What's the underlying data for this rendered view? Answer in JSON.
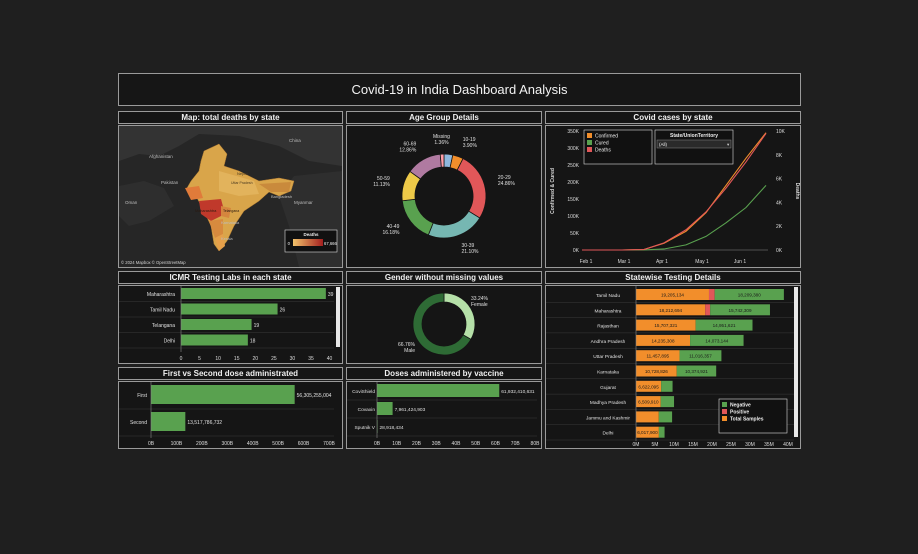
{
  "title": "Covid-19 in India Dashboard Analysis",
  "panels": {
    "map": {
      "header": "Map: total deaths by state",
      "attribution": "© 2024 Mapbox © OpenStreetMap",
      "legend_title": "Deaths",
      "legend_min": "0",
      "legend_max": "67,666",
      "labels": [
        "Afghanistan",
        "Pakistan",
        "China",
        "Nepal",
        "Bangladesh",
        "Myanmar",
        "Maharashtra",
        "Telangana",
        "Karnataka",
        "Kerala",
        "Uttar Pradesh",
        "Oman"
      ]
    },
    "age": {
      "header": "Age Group Details"
    },
    "cases": {
      "header": "Covid cases by state",
      "filter_title": "State/UnionTerritory",
      "filter_value": "(All)"
    },
    "icmr": {
      "header": "ICMR Testing Labs in each state"
    },
    "gender": {
      "header": "Gender without missing values"
    },
    "testing": {
      "header": "Statewise Testing Details"
    },
    "dose": {
      "header": "First vs Second dose administrated"
    },
    "vaccine": {
      "header": "Doses administered by vaccine"
    }
  },
  "chart_data": [
    {
      "id": "age",
      "type": "pie",
      "title": "Age Group Details",
      "categories": [
        "0-9",
        "10-19",
        "20-29",
        "30-39",
        "40-49",
        "50-59",
        "60-69",
        "Missing"
      ],
      "values": [
        3.18,
        3.9,
        24.86,
        21.1,
        16.18,
        11.13,
        12.86,
        1.36
      ],
      "labels": [
        "",
        "10-19\n3.90%",
        "20-29\n24.86%",
        "30-39\n21.10%",
        "40-49\n16.18%",
        "50-59\n11.13%",
        "60-69\n12.86%",
        "Missing\n1.36%"
      ],
      "colors": [
        "#8fb8dd",
        "#f28e2b",
        "#e15759",
        "#76b7b2",
        "#59a14f",
        "#edc948",
        "#b07aa1",
        "#ff9da7"
      ]
    },
    {
      "id": "cases",
      "type": "line",
      "title": "Covid cases by state",
      "x": [
        "Feb 1",
        "Mar 1",
        "Apr 1",
        "May 1",
        "Jun 1"
      ],
      "ylabel": "Confirmed & Cured",
      "y2label": "Deaths",
      "yticks": [
        "0K",
        "50K",
        "100K",
        "150K",
        "200K",
        "250K",
        "300K",
        "350K"
      ],
      "y2ticks": [
        "0K",
        "2K",
        "4K",
        "6K",
        "8K",
        "10K"
      ],
      "ylim": [
        0,
        350000
      ],
      "y2lim": [
        0,
        10000
      ],
      "legend": [
        "Confirmed",
        "Cured",
        "Deaths"
      ],
      "legend_position": "top-left",
      "colors": [
        "#f28e2b",
        "#59a14f",
        "#e15759"
      ],
      "series": [
        {
          "name": "Confirmed",
          "values": [
            0,
            0,
            1500,
            20000,
            55000,
            110000,
            190000,
            270000,
            345000
          ]
        },
        {
          "name": "Cured",
          "values": [
            0,
            0,
            100,
            3000,
            15000,
            40000,
            80000,
            125000,
            190000
          ]
        },
        {
          "name": "Deaths",
          "values": [
            0,
            0,
            40,
            600,
            1700,
            3200,
            5200,
            7400,
            9800
          ]
        }
      ],
      "points": [
        "Feb 1",
        "Mar 1",
        "Mar 15",
        "Apr 1",
        "Apr 15",
        "May 1",
        "May 15",
        "Jun 1",
        "Jun 15"
      ]
    },
    {
      "id": "icmr",
      "type": "bar",
      "title": "ICMR Testing Labs in each state",
      "categories": [
        "Maharashtra",
        "Tamil Nadu",
        "Telangana",
        "Delhi"
      ],
      "values": [
        39,
        26,
        19,
        18
      ],
      "xticks": [
        "0",
        "5",
        "10",
        "15",
        "20",
        "25",
        "30",
        "35",
        "40"
      ],
      "xlim": [
        0,
        42
      ],
      "color": "#59a14f"
    },
    {
      "id": "gender",
      "type": "pie",
      "title": "Gender without missing values",
      "categories": [
        "Female",
        "Male"
      ],
      "values": [
        33.24,
        66.76
      ],
      "labels": [
        "33.24%\nFemale",
        "66.76%\nMale"
      ],
      "colors": [
        "#b5e0a8",
        "#2e6b35"
      ]
    },
    {
      "id": "testing",
      "type": "bar",
      "title": "Statewise Testing Details",
      "categories": [
        "Tamil Nadu",
        "Maharashtra",
        "Rajasthan",
        "Andhra Pradesh",
        "Uttar Pradesh",
        "Karnataka",
        "Gujarat",
        "Madhya Pradesh",
        "Jammu and Kashmir",
        "Delhi"
      ],
      "series": [
        {
          "name": "Total Samples",
          "values": [
            19205134,
            18212694,
            15707321,
            14235308,
            11457895,
            10728826,
            0,
            0,
            0,
            0
          ],
          "labels": [
            "19,205,134",
            "18,212,694",
            "15,707,321",
            "14,235,308",
            "11,457,895",
            "10,728,826",
            "",
            "",
            "",
            ""
          ]
        },
        {
          "name": "Positive",
          "values": [
            1500000,
            1300000,
            0,
            0,
            0,
            0,
            0,
            0,
            0,
            0
          ]
        },
        {
          "name": "Negative",
          "values": [
            18209380,
            15742309,
            14951621,
            14073144,
            11016357,
            10374921,
            3000000,
            3500000,
            3500000,
            1500000
          ],
          "labels": [
            "18,209,380",
            "15,742,309",
            "14,951,621",
            "14,073,144",
            "11,016,357",
            "10,374,921",
            "",
            "",
            "",
            ""
          ]
        }
      ],
      "small_labels": [
        "",
        "",
        "",
        "",
        "",
        "",
        "6,622,095",
        "6,509,910",
        "",
        "6,017,900"
      ],
      "small_totals": [
        0,
        0,
        0,
        0,
        0,
        0,
        6622095,
        6509910,
        6000000,
        6017900
      ],
      "xticks": [
        "0M",
        "5M",
        "10M",
        "15M",
        "20M",
        "25M",
        "30M",
        "35M",
        "40M"
      ],
      "xlim": [
        0,
        40000000
      ],
      "legend": [
        "Negative",
        "Positive",
        "Total Samples"
      ],
      "legend_position": "bottom-right",
      "colors": [
        "#59a14f",
        "#e15759",
        "#f28e2b"
      ]
    },
    {
      "id": "dose",
      "type": "bar",
      "title": "First vs Second dose administrated",
      "categories": [
        "First",
        "Second"
      ],
      "values": [
        565305255004,
        135177867322
      ],
      "labels": [
        "56,305,255,004",
        "13,517,786,732"
      ],
      "xticks": [
        "0B",
        "100B",
        "200B",
        "300B",
        "400B",
        "500B",
        "600B",
        "700B"
      ],
      "xlim": [
        0,
        700
      ],
      "bar_values_b": [
        565,
        135
      ],
      "color": "#59a14f"
    },
    {
      "id": "vaccine",
      "type": "bar",
      "title": "Doses administered by vaccine",
      "categories": [
        "CoviShield",
        "Covaxin",
        "Sputnik V"
      ],
      "values": [
        619,
        79,
        0.29
      ],
      "labels": [
        "61,932,410,631",
        "7,961,424,903",
        "28,918,434"
      ],
      "xticks": [
        "0B",
        "10B",
        "20B",
        "30B",
        "40B",
        "50B",
        "60B",
        "70B",
        "80B"
      ],
      "xlim": [
        0,
        800
      ],
      "color": "#59a14f"
    }
  ]
}
